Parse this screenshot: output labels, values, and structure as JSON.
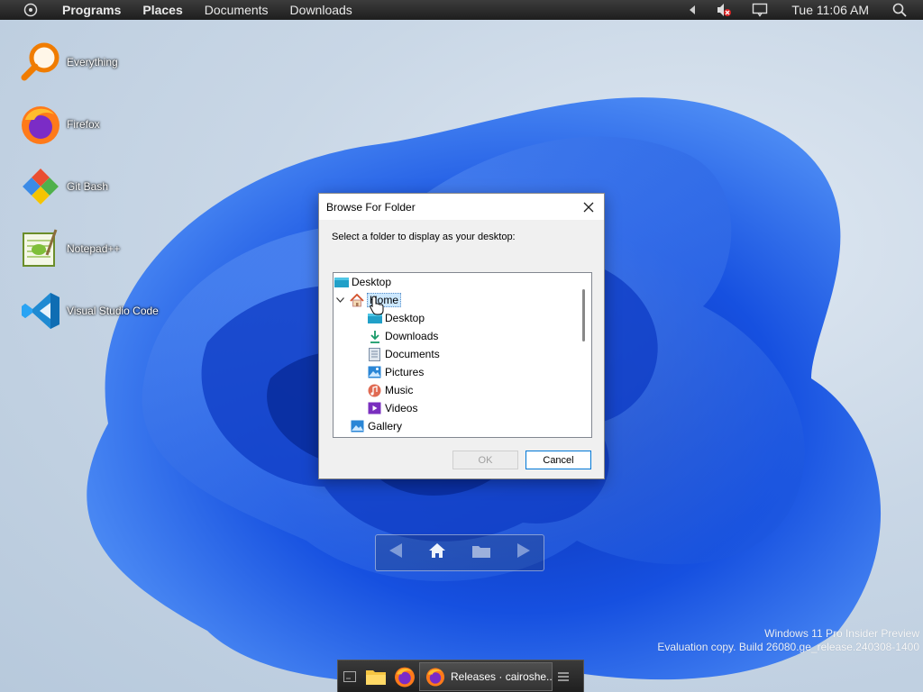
{
  "menubar": {
    "programs": "Programs",
    "places": "Places",
    "documents": "Documents",
    "downloads": "Downloads",
    "clock": "Tue 11:06 AM"
  },
  "desktop_icons": [
    {
      "label": "Everything",
      "icon": "magnifier-icon"
    },
    {
      "label": "Firefox",
      "icon": "firefox-icon"
    },
    {
      "label": "Git Bash",
      "icon": "git-bash-icon"
    },
    {
      "label": "Notepad++",
      "icon": "notepadpp-icon"
    },
    {
      "label": "Visual Studio Code",
      "icon": "vscode-icon"
    }
  ],
  "dialog": {
    "title": "Browse For Folder",
    "instruction": "Select a folder to display as your desktop:",
    "tree": {
      "root": "Desktop",
      "home": "Home",
      "home_children": [
        "Desktop",
        "Downloads",
        "Documents",
        "Pictures",
        "Music",
        "Videos"
      ],
      "gallery": "Gallery"
    },
    "ok_label": "OK",
    "cancel_label": "Cancel"
  },
  "watermark": {
    "line1": "Windows 11 Pro Insider Preview",
    "line2": "Evaluation copy. Build 26080.ge_release.240308-1400"
  },
  "taskbar": {
    "task_label": "Releases · cairoshe..."
  },
  "colors": {
    "menubar": "#2b2b2b",
    "selection": "#cce8ff",
    "accent": "#0078d7",
    "wallpaper_blue": "#1a5fe0"
  }
}
